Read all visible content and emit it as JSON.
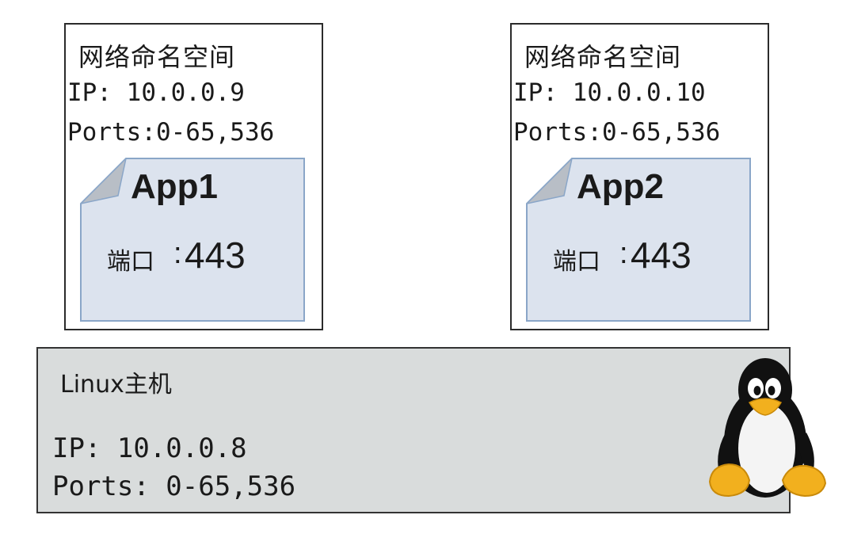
{
  "namespaces": [
    {
      "title": "网络命名空间",
      "ip": "IP: 10.0.0.9",
      "ports": "Ports:0-65,536",
      "app": {
        "name": "App1",
        "port_label": "端口",
        "colon": ":",
        "port": "443"
      }
    },
    {
      "title": "网络命名空间",
      "ip": "IP: 10.0.0.10",
      "ports": "Ports:0-65,536",
      "app": {
        "name": "App2",
        "port_label": "端口",
        "colon": ":",
        "port": "443"
      }
    }
  ],
  "host": {
    "title": "Linux主机",
    "ip": "IP: 10.0.0.8",
    "ports": "Ports: 0-65,536",
    "icon": "tux-penguin-icon"
  },
  "colors": {
    "app_fill": "#dce3ee",
    "app_border": "#8aa6c8",
    "fold": "#b8bec6",
    "host_fill": "#d9dcdc"
  }
}
